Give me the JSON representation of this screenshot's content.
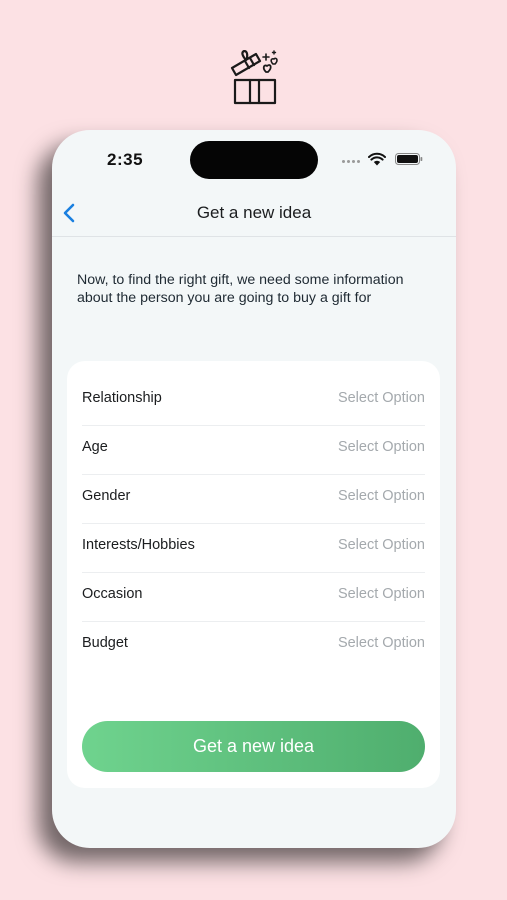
{
  "header_icon": "gift-box-icon",
  "status_bar": {
    "time": "2:35",
    "icons": [
      "wifi-icon",
      "battery-icon"
    ]
  },
  "nav": {
    "back_icon": "chevron-left-icon",
    "title": "Get a new idea"
  },
  "intro_text": "Now, to find the right gift, we need some information about the person you are going to buy a gift for",
  "fields": [
    {
      "label": "Relationship",
      "value": "Select Option"
    },
    {
      "label": "Age",
      "value": "Select Option"
    },
    {
      "label": "Gender",
      "value": "Select Option"
    },
    {
      "label": "Interests/Hobbies",
      "value": "Select Option"
    },
    {
      "label": "Occasion",
      "value": "Select Option"
    },
    {
      "label": "Budget",
      "value": "Select Option"
    }
  ],
  "submit_label": "Get a new idea",
  "colors": {
    "background": "#fce1e4",
    "accent_blue": "#1a7fe0",
    "button_start": "#6fd38e",
    "button_end": "#4fae6e",
    "placeholder": "#a4a9ad"
  }
}
